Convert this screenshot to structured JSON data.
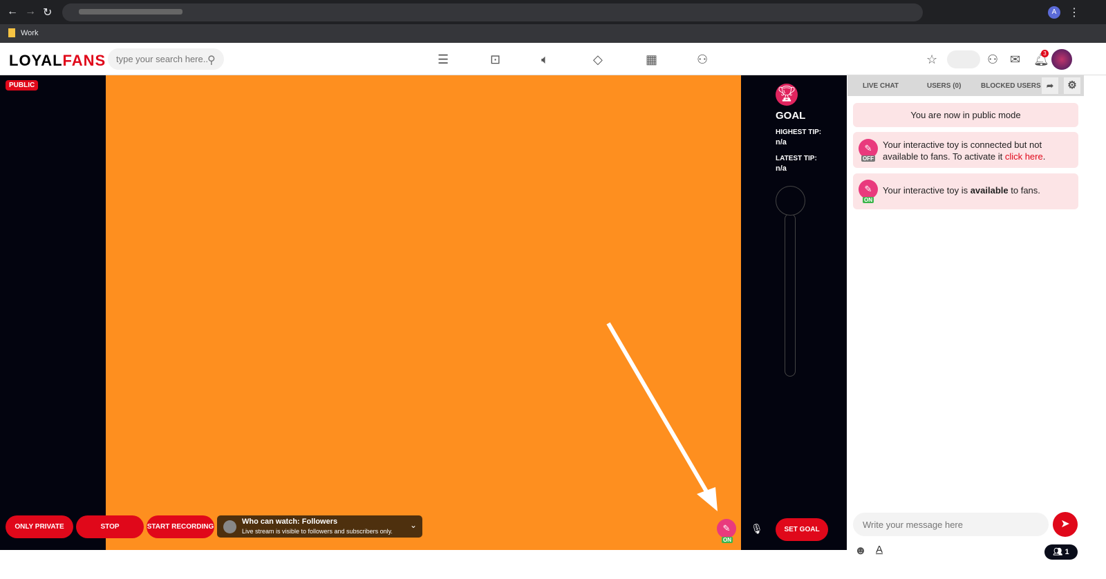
{
  "browser": {
    "bookmark": "Work",
    "profile_initial": "A"
  },
  "header": {
    "logo_a": "LOYAL",
    "logo_b": "FANS",
    "search_placeholder": "type your search here..",
    "notification_count": "3"
  },
  "stream": {
    "mode_badge": "PUBLIC",
    "buttons": {
      "only_private": "ONLY PRIVATE",
      "stop": "STOP",
      "start_recording": "START RECORDING",
      "set_goal": "SET GOAL"
    },
    "who_can_watch": {
      "title": "Who can watch: Followers",
      "subtitle": "Live stream is visible to followers and subscribers only."
    },
    "toy_status": "ON",
    "video_color": "#fe8f1f"
  },
  "goal": {
    "title": "GOAL",
    "highest_tip_label": "HIGHEST TIP:",
    "highest_tip": "n/a",
    "latest_tip_label": "LATEST TIP:",
    "latest_tip": "n/a",
    "progress": 0
  },
  "chat": {
    "tabs": [
      "LIVE CHAT",
      "USERS (0)",
      "BLOCKED USERS"
    ],
    "messages": {
      "public": "You are now in public mode",
      "toy_off_a": "Your interactive toy is connected but not available to fans. To activate it ",
      "toy_off_link": "click here",
      "toy_off_end": ".",
      "off_badge": "OFF",
      "toy_on_a": "Your interactive toy is ",
      "toy_on_b": "available",
      "toy_on_c": " to fans.",
      "on_badge": "ON"
    },
    "input_placeholder": "Write your message here",
    "viewers": "1"
  },
  "colors": {
    "accent": "#e0081a",
    "toy": "#e93a7d"
  }
}
